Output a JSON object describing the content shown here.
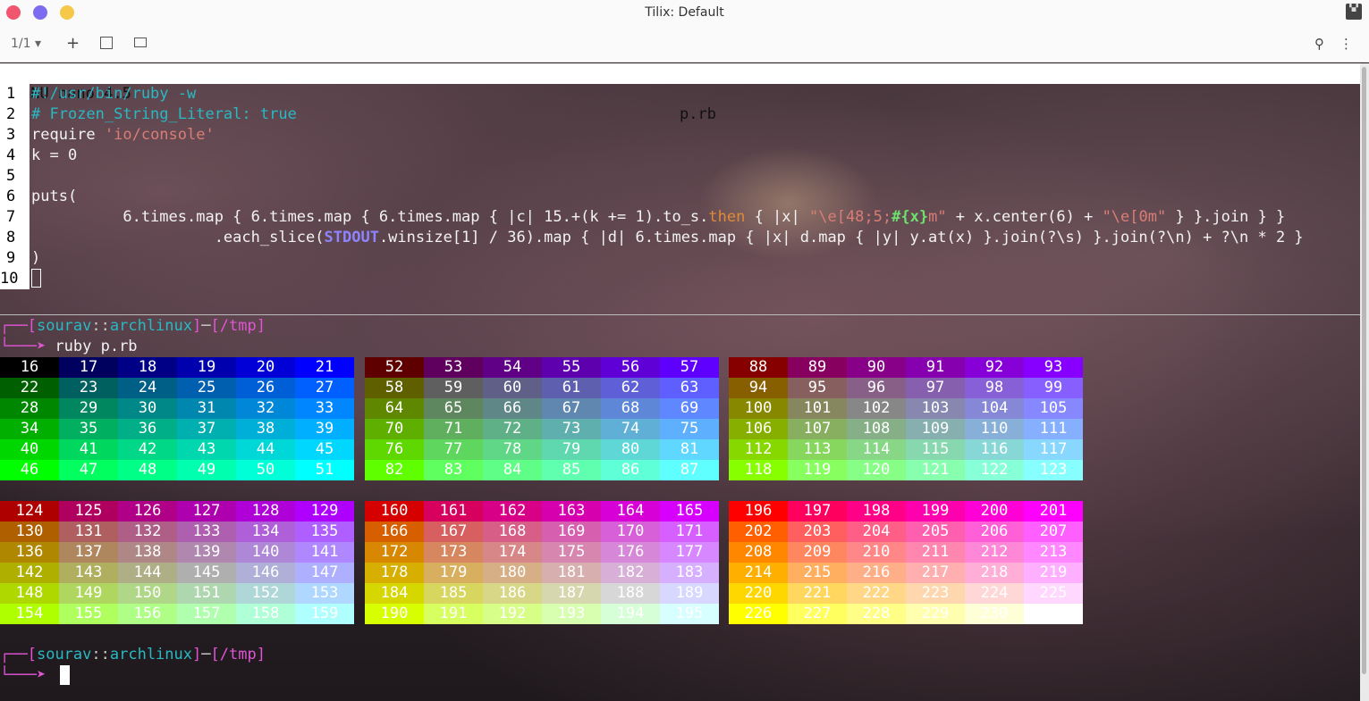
{
  "window": {
    "title": "Tilix: Default"
  },
  "toolbar": {
    "session": "1/1 ▾",
    "add": "+",
    "search": "⚲",
    "menu": "⋮"
  },
  "nano": {
    "version": "GNU nano 4.5",
    "filename": "p.rb",
    "line_numbers": [
      "1",
      "2",
      "3",
      "4",
      "5",
      "6",
      "7",
      "8",
      "9",
      "10"
    ]
  },
  "prompt": {
    "user": "sourav",
    "sep": "::",
    "host": "archlinux",
    "path": "/tmp",
    "command": "ruby p.rb"
  },
  "colors": {
    "accent_magenta": "#e055d4",
    "accent_cyan": "#28b9c4",
    "ruby_const": "#8f84ff"
  },
  "palette_blocks": [
    [
      16,
      17,
      18,
      19,
      20,
      21,
      22,
      23,
      24,
      25,
      26,
      27,
      28,
      29,
      30,
      31,
      32,
      33,
      34,
      35,
      36,
      37,
      38,
      39,
      40,
      41,
      42,
      43,
      44,
      45,
      46,
      47,
      48,
      49,
      50,
      51
    ],
    [
      52,
      53,
      54,
      55,
      56,
      57,
      58,
      59,
      60,
      61,
      62,
      63,
      64,
      65,
      66,
      67,
      68,
      69,
      70,
      71,
      72,
      73,
      74,
      75,
      76,
      77,
      78,
      79,
      80,
      81,
      82,
      83,
      84,
      85,
      86,
      87
    ],
    [
      88,
      89,
      90,
      91,
      92,
      93,
      94,
      95,
      96,
      97,
      98,
      99,
      100,
      101,
      102,
      103,
      104,
      105,
      106,
      107,
      108,
      109,
      110,
      111,
      112,
      113,
      114,
      115,
      116,
      117,
      118,
      119,
      120,
      121,
      122,
      123
    ],
    [
      124,
      125,
      126,
      127,
      128,
      129,
      130,
      131,
      132,
      133,
      134,
      135,
      136,
      137,
      138,
      139,
      140,
      141,
      142,
      143,
      144,
      145,
      146,
      147,
      148,
      149,
      150,
      151,
      152,
      153,
      154,
      155,
      156,
      157,
      158,
      159
    ],
    [
      160,
      161,
      162,
      163,
      164,
      165,
      166,
      167,
      168,
      169,
      170,
      171,
      172,
      173,
      174,
      175,
      176,
      177,
      178,
      179,
      180,
      181,
      182,
      183,
      184,
      185,
      186,
      187,
      188,
      189,
      190,
      191,
      192,
      193,
      194,
      195
    ],
    [
      196,
      197,
      198,
      199,
      200,
      201,
      202,
      203,
      204,
      205,
      206,
      207,
      208,
      209,
      210,
      211,
      212,
      213,
      214,
      215,
      216,
      217,
      218,
      219,
      220,
      221,
      222,
      223,
      224,
      225,
      226,
      227,
      228,
      229,
      230,
      231
    ]
  ]
}
